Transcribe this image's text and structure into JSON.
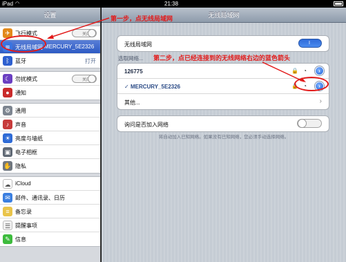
{
  "statusbar": {
    "carrier": "iPad",
    "time": "21:38"
  },
  "sidebar": {
    "title": "设置",
    "group1": [
      {
        "label": "飞行模式",
        "icon": "airplane-icon",
        "control": "switch",
        "switch_text": "关闭"
      },
      {
        "label": "无线局域网",
        "icon": "wifi-icon",
        "value": "MERCURY_5E2326",
        "selected": true
      },
      {
        "label": "蓝牙",
        "icon": "bluetooth-icon",
        "value": "打开"
      }
    ],
    "group2": [
      {
        "label": "勿扰模式",
        "icon": "moon-icon",
        "control": "switch",
        "switch_text": "关闭"
      },
      {
        "label": "通知",
        "icon": "notifications-icon"
      }
    ],
    "group3": [
      {
        "label": "通用",
        "icon": "gear-icon"
      },
      {
        "label": "声音",
        "icon": "speaker-icon"
      },
      {
        "label": "亮度与墙纸",
        "icon": "brightness-icon"
      },
      {
        "label": "电子相框",
        "icon": "picture-frame-icon"
      },
      {
        "label": "隐私",
        "icon": "hand-icon"
      }
    ],
    "group4": [
      {
        "label": "iCloud",
        "icon": "cloud-icon"
      },
      {
        "label": "邮件、通讯录、日历",
        "icon": "mail-icon"
      },
      {
        "label": "备忘录",
        "icon": "notes-icon"
      },
      {
        "label": "提醒事项",
        "icon": "reminders-icon"
      },
      {
        "label": "信息",
        "icon": "messages-icon"
      }
    ]
  },
  "main": {
    "title": "无线局域网",
    "wifi_row": {
      "label": "无线局域网",
      "switch_text": "I"
    },
    "section_label": "选取网络...",
    "networks": [
      {
        "name": "126775",
        "secured": true
      },
      {
        "name": "MERCURY_5E2326",
        "secured": true,
        "connected": true,
        "checkmark": "✓"
      }
    ],
    "other_label": "其他...",
    "ask_row": {
      "label": "询问是否加入网络"
    },
    "footnote": "将自动加入已知网络。如果没有已知网络，您必须手动选择网络。"
  },
  "annotations": {
    "step1": "第一步，点无线局域网",
    "step2": "第二步，点已经连接到的无线网络右边的蓝色箭头"
  },
  "colors": {
    "annotation": "#e21b1b",
    "accent": "#2c5ac4",
    "toggle_on": "#2f6bd8"
  }
}
